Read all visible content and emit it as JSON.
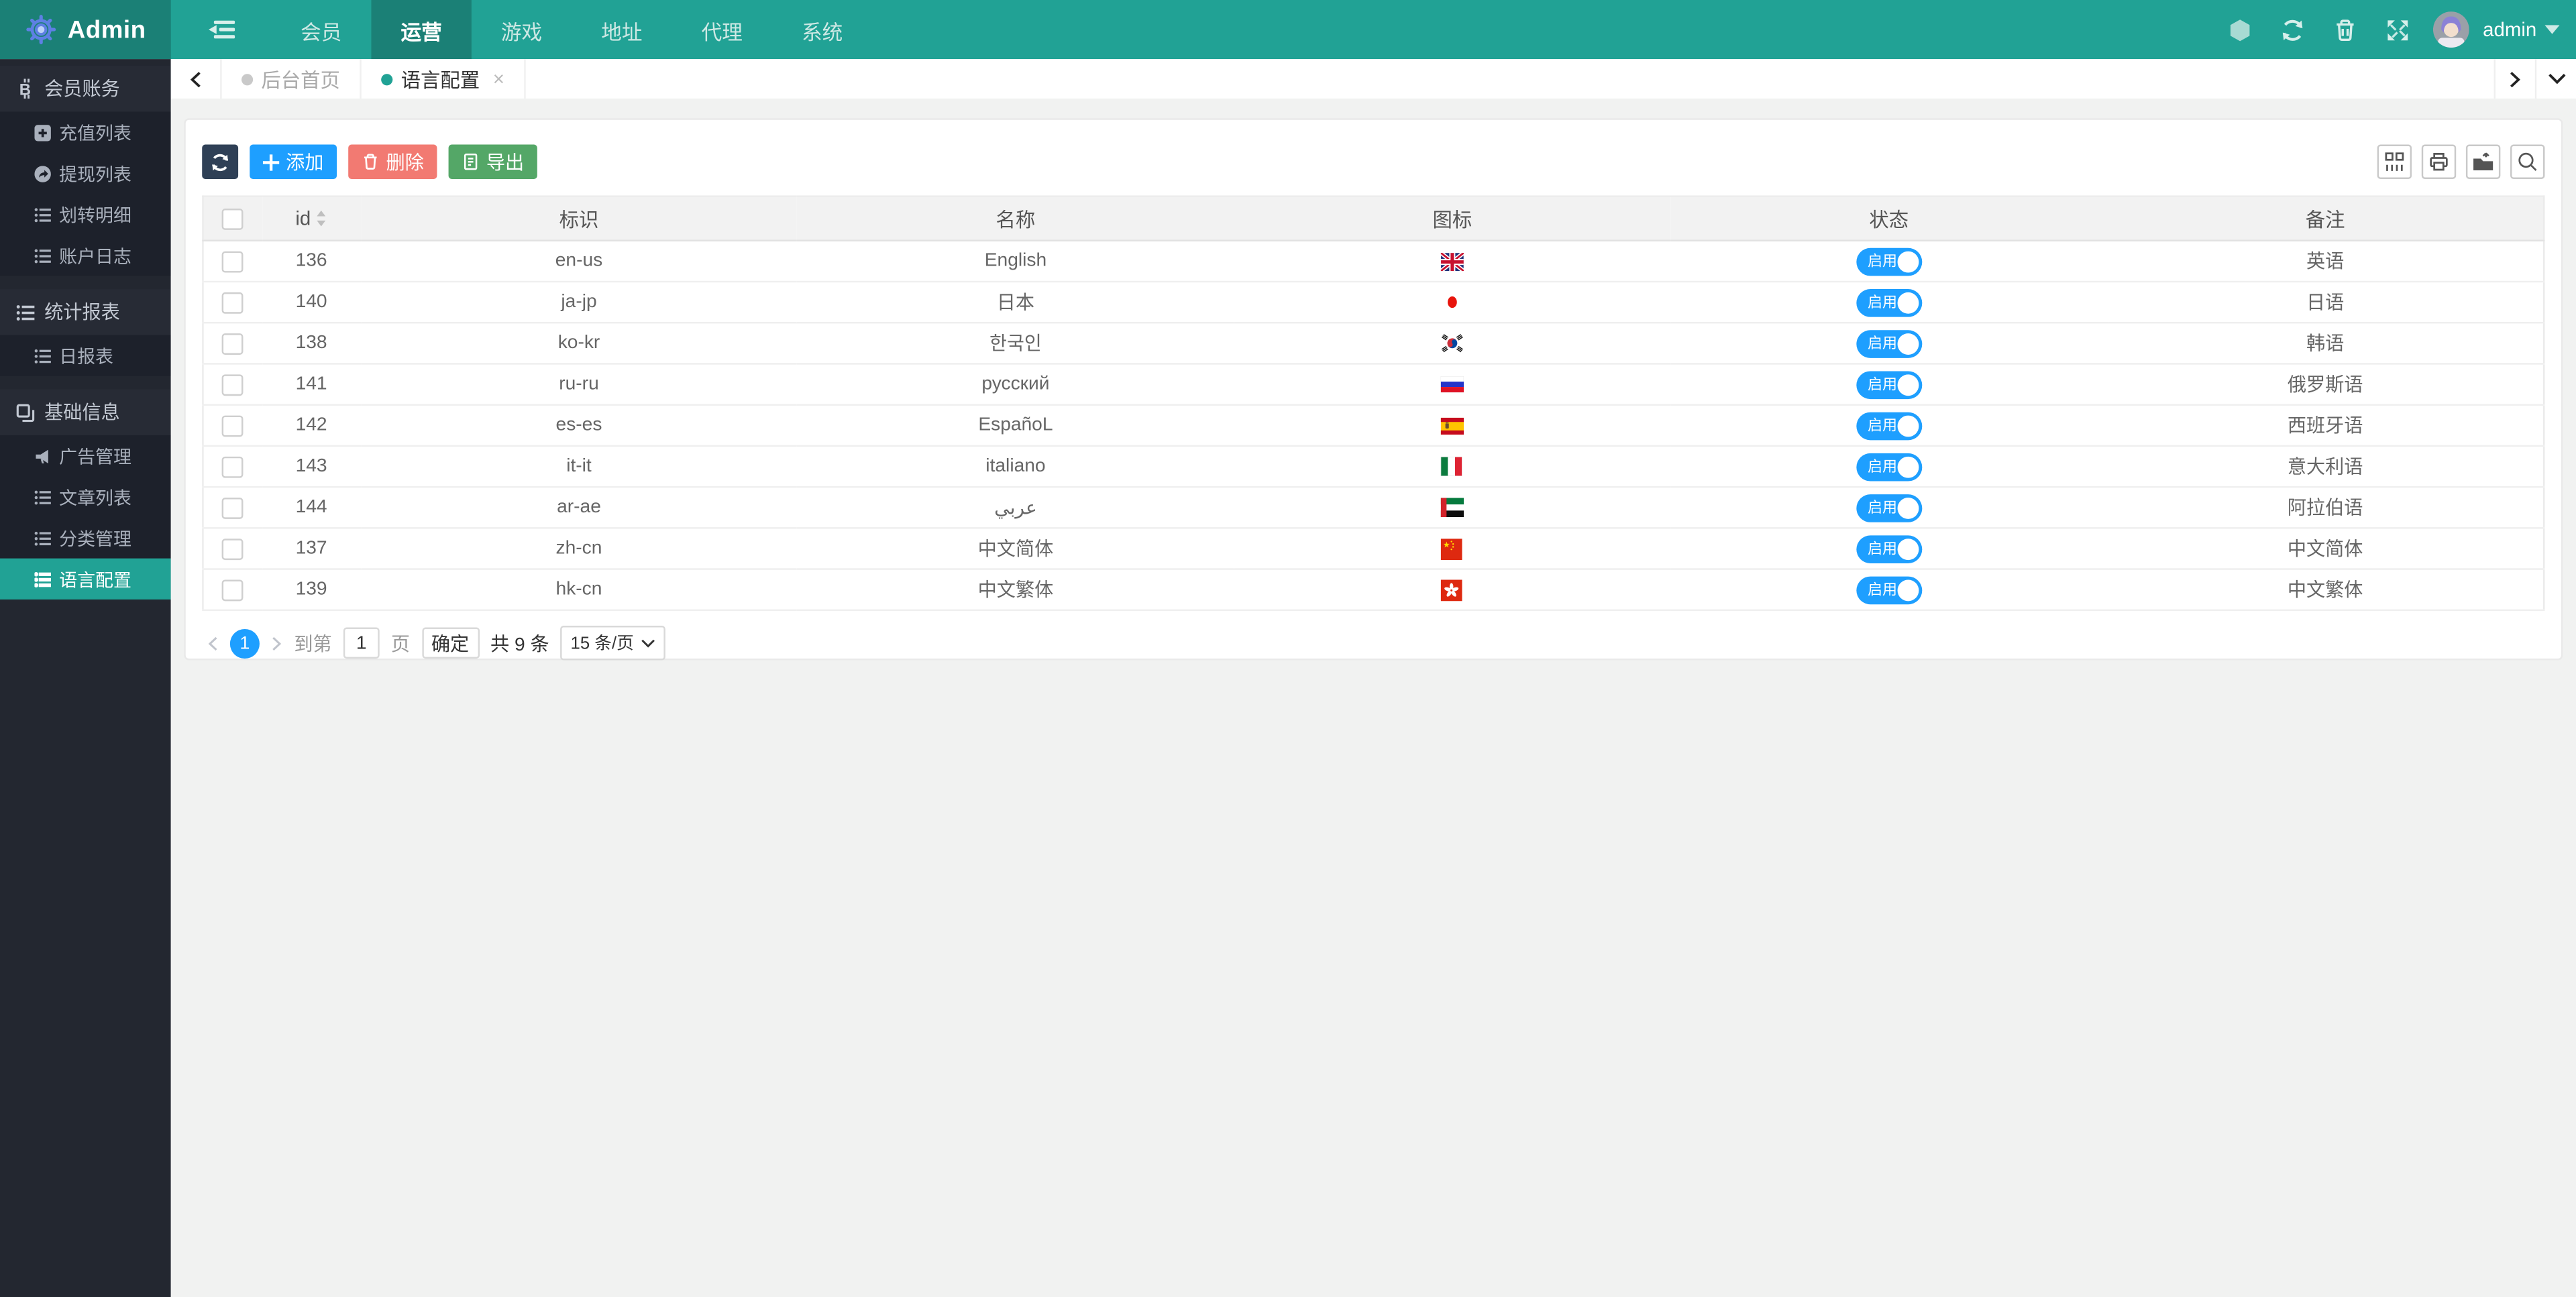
{
  "navbar": {
    "brand": "Admin",
    "items": [
      {
        "label": "会员",
        "active": false
      },
      {
        "label": "运营",
        "active": true
      },
      {
        "label": "游戏",
        "active": false
      },
      {
        "label": "地址",
        "active": false
      },
      {
        "label": "代理",
        "active": false
      },
      {
        "label": "系统",
        "active": false
      }
    ],
    "right_icons": [
      "hexagon-icon",
      "refresh-icon",
      "trash-icon",
      "fullscreen-icon"
    ],
    "user": {
      "name": "admin"
    }
  },
  "sidebar": {
    "sections": [
      {
        "label": "会员账务",
        "icon": "bitcoin-icon",
        "items": [
          {
            "label": "充值列表",
            "icon": "plus-square-icon"
          },
          {
            "label": "提现列表",
            "icon": "share-icon"
          },
          {
            "label": "划转明细",
            "icon": "list-icon"
          },
          {
            "label": "账户日志",
            "icon": "list-icon"
          }
        ]
      },
      {
        "label": "统计报表",
        "icon": "list-icon",
        "items": [
          {
            "label": "日报表",
            "icon": "list-icon"
          }
        ]
      },
      {
        "label": "基础信息",
        "icon": "copy-icon",
        "items": [
          {
            "label": "广告管理",
            "icon": "horn-icon"
          },
          {
            "label": "文章列表",
            "icon": "list-icon"
          },
          {
            "label": "分类管理",
            "icon": "list-icon"
          },
          {
            "label": "语言配置",
            "icon": "list-icon",
            "active": true
          }
        ]
      }
    ]
  },
  "tabs": {
    "items": [
      {
        "label": "后台首页",
        "active": false
      },
      {
        "label": "语言配置",
        "active": true,
        "close": "×"
      }
    ]
  },
  "toolbar": {
    "add_label": "添加",
    "delete_label": "删除",
    "export_label": "导出",
    "right_icons": [
      "columns-icon",
      "printer-icon",
      "export-folder-icon",
      "search-icon"
    ]
  },
  "table": {
    "columns": [
      "id",
      "标识",
      "名称",
      "图标",
      "状态",
      "备注"
    ],
    "rows": [
      {
        "id": "136",
        "code": "en-us",
        "name": "English",
        "flag": "gb",
        "status": "启用",
        "remark": "英语"
      },
      {
        "id": "140",
        "code": "ja-jp",
        "name": "日本",
        "flag": "jp",
        "status": "启用",
        "remark": "日语"
      },
      {
        "id": "138",
        "code": "ko-kr",
        "name": "한국인",
        "flag": "kr",
        "status": "启用",
        "remark": "韩语"
      },
      {
        "id": "141",
        "code": "ru-ru",
        "name": "русский",
        "flag": "ru",
        "status": "启用",
        "remark": "俄罗斯语"
      },
      {
        "id": "142",
        "code": "es-es",
        "name": "EspañoL",
        "flag": "es",
        "status": "启用",
        "remark": "西班牙语"
      },
      {
        "id": "143",
        "code": "it-it",
        "name": "italiano",
        "flag": "it",
        "status": "启用",
        "remark": "意大利语"
      },
      {
        "id": "144",
        "code": "ar-ae",
        "name": "عربي",
        "flag": "ae",
        "status": "启用",
        "remark": "阿拉伯语"
      },
      {
        "id": "137",
        "code": "zh-cn",
        "name": "中文简体",
        "flag": "cn",
        "status": "启用",
        "remark": "中文简体"
      },
      {
        "id": "139",
        "code": "hk-cn",
        "name": "中文繁体",
        "flag": "hk",
        "status": "启用",
        "remark": "中文繁体"
      }
    ]
  },
  "pagination": {
    "current_page": "1",
    "goto_label": "到第",
    "page_input_value": "1",
    "page_unit_label": "页",
    "confirm_label": "确定",
    "total_label": "共 9 条",
    "page_size_label": "15 条/页"
  },
  "colors": {
    "navbar_teal": "#21A295",
    "navbar_dark_teal": "#1B8076",
    "sidebar_bg": "#232730",
    "sidebar_section_bg": "#272B35",
    "sidebar_submenu_bg": "#1D212B",
    "active_teal": "#21A295",
    "primary_blue": "#1E9FFF",
    "danger_red": "#F27A72",
    "success_green": "#54A767",
    "dark_navy": "#2F4056",
    "page_bg": "#F1F2F1",
    "header_gray": "#F2F2F2"
  }
}
